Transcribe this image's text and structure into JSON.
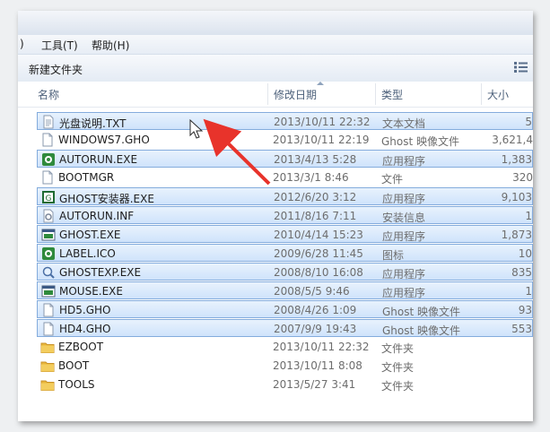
{
  "menu": {
    "partial_label": ")",
    "tools_label": "工具(T)",
    "help_label": "帮助(H)"
  },
  "toolbar": {
    "new_folder_label": "新建文件夹",
    "view_icon": "view-options-icon"
  },
  "columns": {
    "name": "名称",
    "date": "修改日期",
    "type": "类型",
    "size": "大小"
  },
  "files": [
    {
      "name": "光盘说明.TXT",
      "date": "2013/10/11 22:32",
      "type": "文本文档",
      "size": "5",
      "icon": "text-file-icon",
      "selected": true
    },
    {
      "name": "WINDOWS7.GHO",
      "date": "2013/10/11 22:19",
      "type": "Ghost 映像文件",
      "size": "3,621,4",
      "icon": "generic-file-icon",
      "selected": false
    },
    {
      "name": "AUTORUN.EXE",
      "date": "2013/4/13 5:28",
      "type": "应用程序",
      "size": "1,383",
      "icon": "autorun-exe-icon",
      "selected": true
    },
    {
      "name": "BOOTMGR",
      "date": "2013/3/1 8:46",
      "type": "文件",
      "size": "320",
      "icon": "generic-file-icon",
      "selected": false
    },
    {
      "name": "GHOST安装器.EXE",
      "date": "2012/6/20 3:12",
      "type": "应用程序",
      "size": "9,103",
      "icon": "installer-exe-icon",
      "selected": true
    },
    {
      "name": "AUTORUN.INF",
      "date": "2011/8/16 7:11",
      "type": "安装信息",
      "size": "1",
      "icon": "settings-file-icon",
      "selected": true
    },
    {
      "name": "GHOST.EXE",
      "date": "2010/4/14 15:23",
      "type": "应用程序",
      "size": "1,873",
      "icon": "window-exe-icon",
      "selected": true
    },
    {
      "name": "LABEL.ICO",
      "date": "2009/6/28 11:45",
      "type": "图标",
      "size": "10",
      "icon": "autorun-exe-icon",
      "selected": true
    },
    {
      "name": "GHOSTEXP.EXE",
      "date": "2008/8/10 16:08",
      "type": "应用程序",
      "size": "835",
      "icon": "magnifier-exe-icon",
      "selected": true
    },
    {
      "name": "MOUSE.EXE",
      "date": "2008/5/5 9:46",
      "type": "应用程序",
      "size": "1",
      "icon": "window-exe-icon",
      "selected": true
    },
    {
      "name": "HD5.GHO",
      "date": "2008/4/26 1:09",
      "type": "Ghost 映像文件",
      "size": "93",
      "icon": "generic-file-icon",
      "selected": true
    },
    {
      "name": "HD4.GHO",
      "date": "2007/9/9 19:43",
      "type": "Ghost 映像文件",
      "size": "553",
      "icon": "generic-file-icon",
      "selected": true
    },
    {
      "name": "EZBOOT",
      "date": "2013/10/11 22:32",
      "type": "文件夹",
      "size": "",
      "icon": "folder-icon",
      "selected": false
    },
    {
      "name": "BOOT",
      "date": "2013/10/11 8:08",
      "type": "文件夹",
      "size": "",
      "icon": "folder-icon",
      "selected": false
    },
    {
      "name": "TOOLS",
      "date": "2013/5/27 3:41",
      "type": "文件夹",
      "size": "",
      "icon": "folder-icon",
      "selected": false
    }
  ],
  "colors": {
    "selection_fill": "#d7e8fc",
    "selection_border": "#84acdd",
    "arrow": "#e8332b",
    "folder": "#e8b63a"
  }
}
